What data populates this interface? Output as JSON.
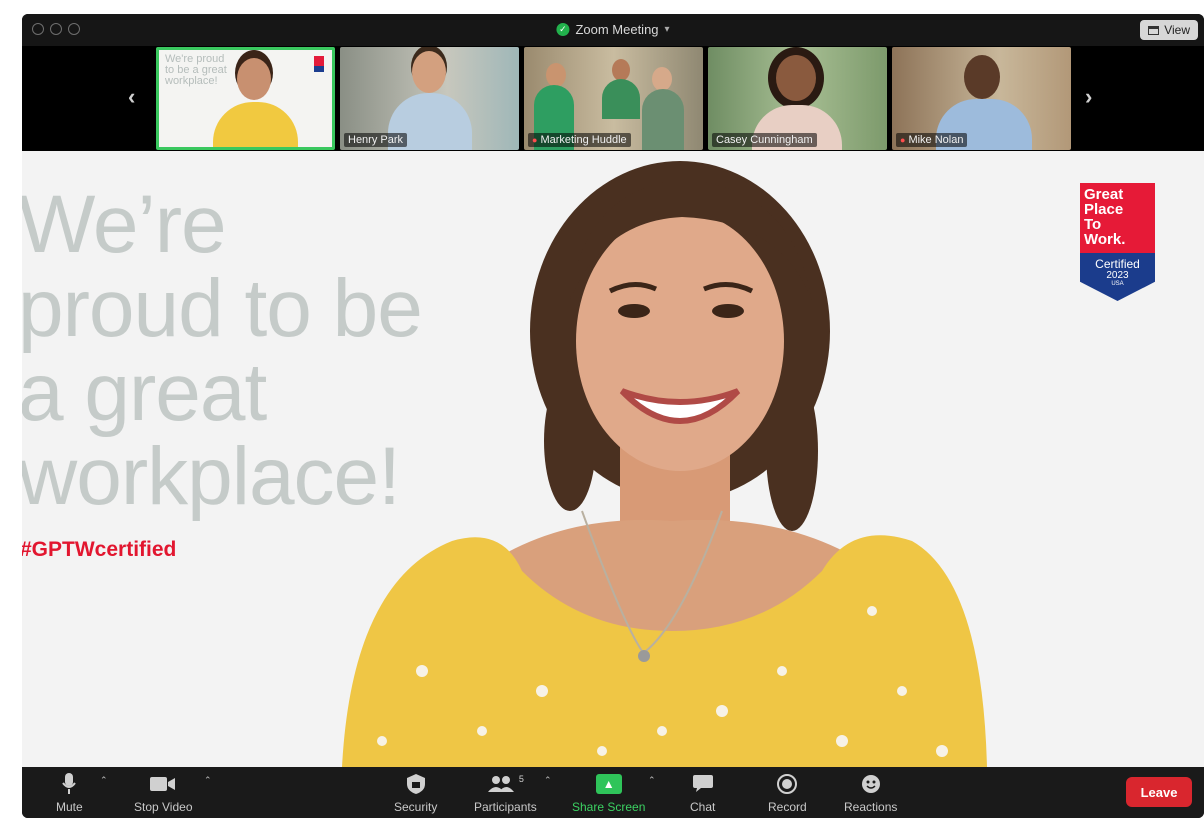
{
  "window": {
    "title": "Zoom Meeting",
    "view_label": "View"
  },
  "strip": {
    "participants": [
      {
        "name": "",
        "mini_text": "We're proud to be a great workplace!"
      },
      {
        "name": "Henry Park"
      },
      {
        "name": "Marketing Huddle"
      },
      {
        "name": "Casey Cunningham"
      },
      {
        "name": "Mike Nolan"
      }
    ]
  },
  "main": {
    "headline": [
      "We’re",
      "proud to be",
      "a great",
      "workplace!"
    ],
    "hashtag": "#GPTWcertified",
    "badge": {
      "line1": "Great",
      "line2": "Place",
      "line3": "To",
      "line4": "Work.",
      "certified": "Certified",
      "year": "2023",
      "country": "USA"
    }
  },
  "toolbar": {
    "mute": "Mute",
    "stop_video": "Stop Video",
    "security": "Security",
    "participants": "Participants",
    "participant_count": "5",
    "share_screen": "Share Screen",
    "chat": "Chat",
    "record": "Record",
    "reactions": "Reactions",
    "leave": "Leave"
  },
  "colors": {
    "share_green": "#2fc45a",
    "leave_red": "#d9262e",
    "active_border": "#3ac85f",
    "gptw_red": "#e61a37",
    "gptw_blue": "#1b3c8c"
  }
}
